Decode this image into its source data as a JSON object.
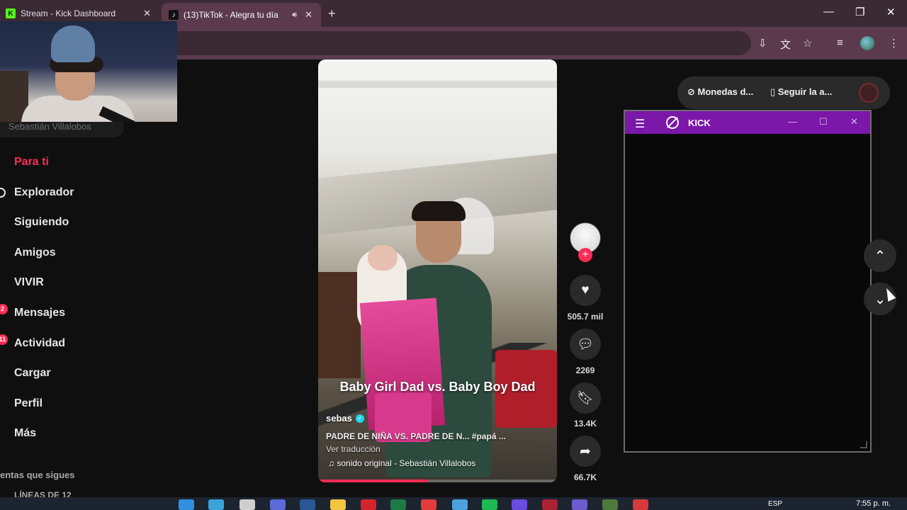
{
  "browser": {
    "tabs": [
      {
        "title": "Stream - Kick Dashboard",
        "favicon": "K",
        "active": false
      },
      {
        "title": "(13)TikTok - Alegra tu día",
        "favicon": "♪",
        "active": true
      }
    ]
  },
  "webcam": {
    "streamer_name": "Sebastián Villalobos"
  },
  "sidebar": {
    "items": [
      {
        "label": "Para ti",
        "active": true,
        "icon": "home-icon"
      },
      {
        "label": "Explorador",
        "active": false,
        "icon": "compass-icon"
      },
      {
        "label": "Siguiendo",
        "active": false,
        "icon": "following-icon"
      },
      {
        "label": "Amigos",
        "active": false,
        "icon": "friends-icon"
      },
      {
        "label": "VIVIR",
        "active": false,
        "icon": "live-icon"
      },
      {
        "label": "Mensajes",
        "active": false,
        "icon": "messages-icon",
        "badge": "2"
      },
      {
        "label": "Actividad",
        "active": false,
        "icon": "activity-icon",
        "badge": "11"
      },
      {
        "label": "Cargar",
        "active": false,
        "icon": "upload-icon"
      },
      {
        "label": "Perfil",
        "active": false,
        "icon": "profile-icon"
      },
      {
        "label": "Más",
        "active": false,
        "icon": "more-icon"
      }
    ],
    "following_section_title": "entas que sigues",
    "following_section_sub": "LÍNEAS DE 12"
  },
  "video": {
    "overlay_caption": "Baby Girl Dad vs. Baby Boy Dad",
    "author": "sebas",
    "description": "PADRE DE NIÑA VS. PADRE DE N... #papá ...",
    "see_translation": "Ver traducción",
    "sound": "sonido original - Sebastián Villalobos",
    "progress_percent": 46
  },
  "actions": {
    "likes": "505.7 mil",
    "comments": "2269",
    "saves": "13.4K",
    "shares": "66.7K"
  },
  "top_right": {
    "coins_label": "Monedas d...",
    "follow_app_label": "Seguir la a..."
  },
  "kick_window": {
    "title": "KICK",
    "accent": "#7b17a9"
  },
  "taskbar": {
    "language": "ESP",
    "time": "7:55 p. m."
  },
  "colors": {
    "tiktok_red": "#fe2c55",
    "chrome_frame": "#5a3a4c"
  }
}
